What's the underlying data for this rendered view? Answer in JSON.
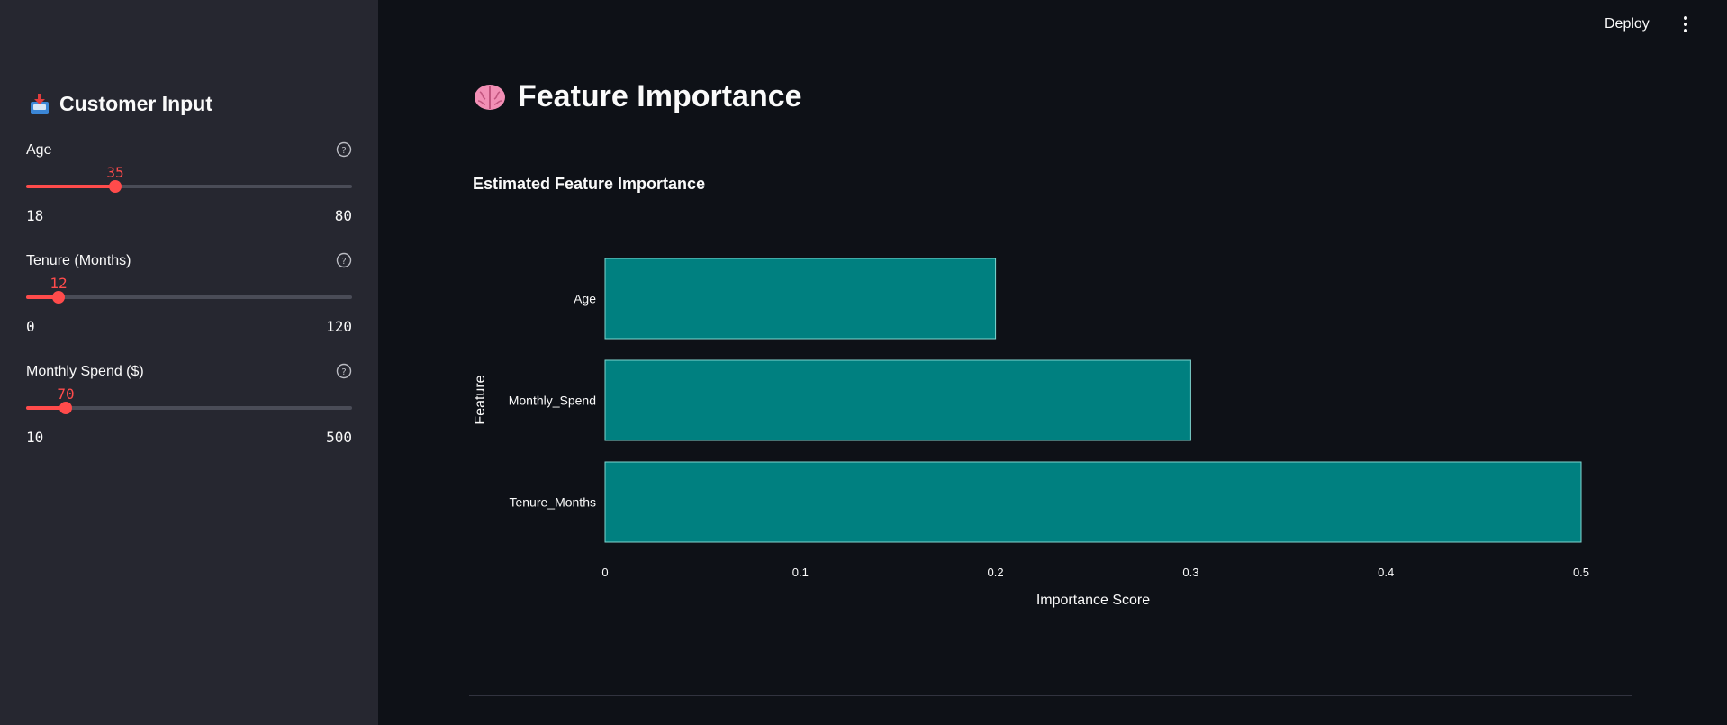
{
  "header": {
    "deploy_label": "Deploy"
  },
  "sidebar": {
    "title": "Customer Input",
    "title_icon": "inbox-tray-icon",
    "sliders": [
      {
        "label": "Age",
        "value": "35",
        "min": "18",
        "max": "80"
      },
      {
        "label": "Tenure (Months)",
        "value": "12",
        "min": "0",
        "max": "120"
      },
      {
        "label": "Monthly Spend ($)",
        "value": "70",
        "min": "10",
        "max": "500"
      }
    ]
  },
  "main": {
    "title": "Feature Importance",
    "title_icon": "brain-icon",
    "chart_heading": "Estimated Feature Importance"
  },
  "colors": {
    "accent": "#ff4b4b",
    "bar_fill": "#008080",
    "bar_edge": "#7fd6d0",
    "background": "#0e1117",
    "sidebar_bg": "#262730"
  },
  "chart_data": {
    "type": "bar",
    "orientation": "horizontal",
    "title": "Estimated Feature Importance",
    "categories": [
      "Age",
      "Monthly_Spend",
      "Tenure_Months"
    ],
    "values": [
      0.2,
      0.3,
      0.5
    ],
    "xlabel": "Importance Score",
    "ylabel": "Feature",
    "xlim": [
      0,
      0.5
    ],
    "xticks": [
      "0",
      "0.1",
      "0.2",
      "0.3",
      "0.4",
      "0.5"
    ],
    "grid": false,
    "legend": "none"
  }
}
